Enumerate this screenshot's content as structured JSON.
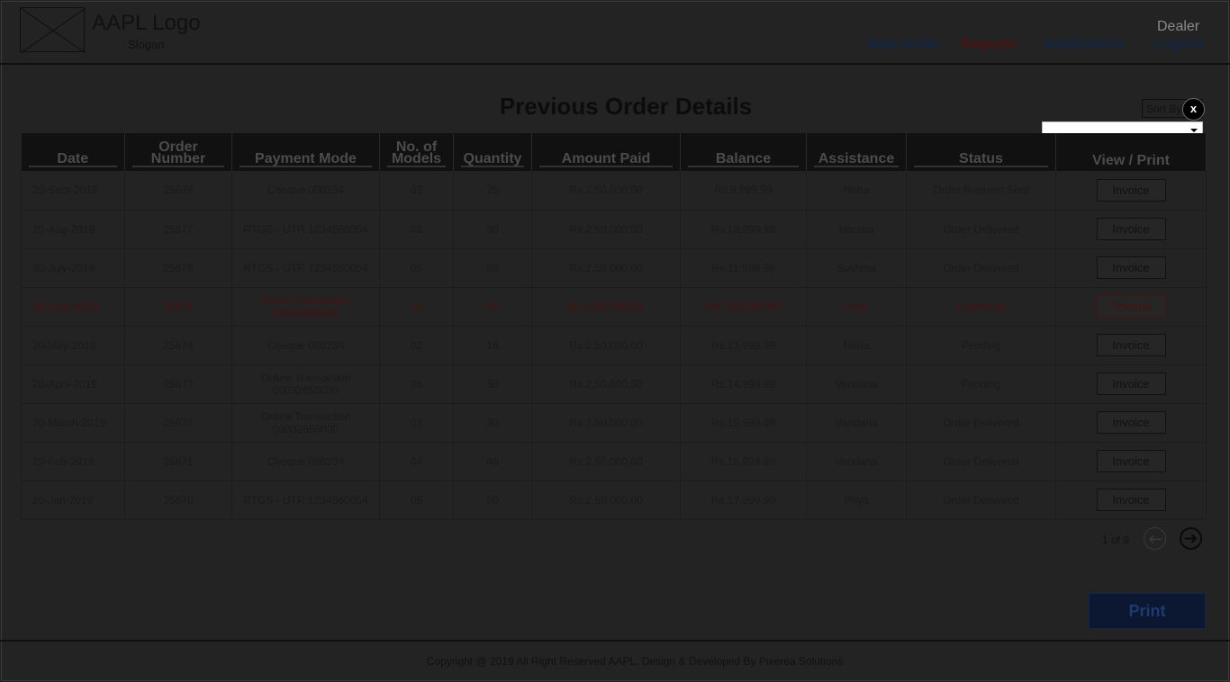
{
  "header": {
    "logo_text": "AAPL Logo",
    "slogan": "Slogan",
    "nav": {
      "new_order": "New Order",
      "reports": "Reports",
      "notification": "Notification",
      "logout": "Logout"
    },
    "user_role": "Dealer"
  },
  "page_title": "Previous Order Details",
  "sort": {
    "label": "Sort By",
    "close_label": "x",
    "selected_value": ""
  },
  "table": {
    "headers": [
      "Date",
      "Order Number",
      "Payment Mode",
      "No. of Models",
      "Quantity",
      "Amount Paid",
      "Balance",
      "Assistance",
      "Status",
      "View / Print"
    ],
    "rows": [
      {
        "date": "20-Sept-2019",
        "order": "25678",
        "payment": "Cheque 000234",
        "models": "02",
        "qty": "25",
        "paid": "Rs.2,50,000.00",
        "balance": "Rs.9,999.99",
        "assist": "Neha",
        "status": "Order Request Sent",
        "action": "Invoice"
      },
      {
        "date": "20-Aug-2019",
        "order": "25677",
        "payment": "RTGS - UTR 1234560054",
        "models": "03",
        "qty": "30",
        "paid": "Rs.2,50,000.00",
        "balance": "Rs.10,999.99",
        "assist": "Harsha",
        "status": "Order Delivered",
        "action": "Invoice"
      },
      {
        "date": "20-July-2019",
        "order": "25676",
        "payment": "RTGS - UTR 1234560054",
        "models": "05",
        "qty": "60",
        "paid": "Rs.2,50,000.00",
        "balance": "Rs.11,999.99",
        "assist": "Sushma",
        "status": "Order Delivered",
        "action": "Invoice"
      },
      {
        "date": "20-June-2019",
        "order": "25675",
        "payment": "Online Transaction 00032650030",
        "models": "04",
        "qty": "45",
        "paid": "Rs.2,50,000.00",
        "balance": "Rs.2,50,000.00",
        "assist": "Priya",
        "status": "Cancelled",
        "action": "Reissue"
      },
      {
        "date": "20-May-2019",
        "order": "25674",
        "payment": "Cheque 000234",
        "models": "02",
        "qty": "18",
        "paid": "Rs.2,50,000.00",
        "balance": "Rs.13,999.99",
        "assist": "Neha",
        "status": "Pending",
        "action": "Invoice"
      },
      {
        "date": "20-April-2019",
        "order": "25673",
        "payment": "Online Transaction 00032650030",
        "models": "06",
        "qty": "30",
        "paid": "Rs.2,50,000.00",
        "balance": "Rs.14,999.99",
        "assist": "Vandana",
        "status": "Pending",
        "action": "Invoice"
      },
      {
        "date": "20-March-2019",
        "order": "25672",
        "payment": "Online Transaction 00032650030",
        "models": "03",
        "qty": "30",
        "paid": "Rs.2,50,000.00",
        "balance": "Rs.15,999.99",
        "assist": "Vandana",
        "status": "Order Delivered",
        "action": "Invoice"
      },
      {
        "date": "20-Feb-2019",
        "order": "25671",
        "payment": "Cheque 000234",
        "models": "04",
        "qty": "40",
        "paid": "Rs.2,50,000.00",
        "balance": "Rs.16,999.99",
        "assist": "Vandana",
        "status": "Order Delivered",
        "action": "Invoice"
      },
      {
        "date": "20-Jan-2019",
        "order": "25670",
        "payment": "RTGS - UTR 1234560054",
        "models": "05",
        "qty": "50",
        "paid": "Rs.2,50,000.00",
        "balance": "Rs.17,999.99",
        "assist": "Priya",
        "status": "Order Delivered",
        "action": "Invoice"
      }
    ]
  },
  "pagination": {
    "info": "1 of 9",
    "prev_icon": "arrow-left-icon",
    "next_icon": "arrow-right-icon"
  },
  "print_label": "Print",
  "footer": "Copyright @ 2019 All Right Reserved AAPL. Design & Developed By Pixerea Solutions",
  "colors": {
    "background": "#232323",
    "cancelled": "#4a1111",
    "nav_link": "#122544",
    "print_button": "#0c1731"
  }
}
